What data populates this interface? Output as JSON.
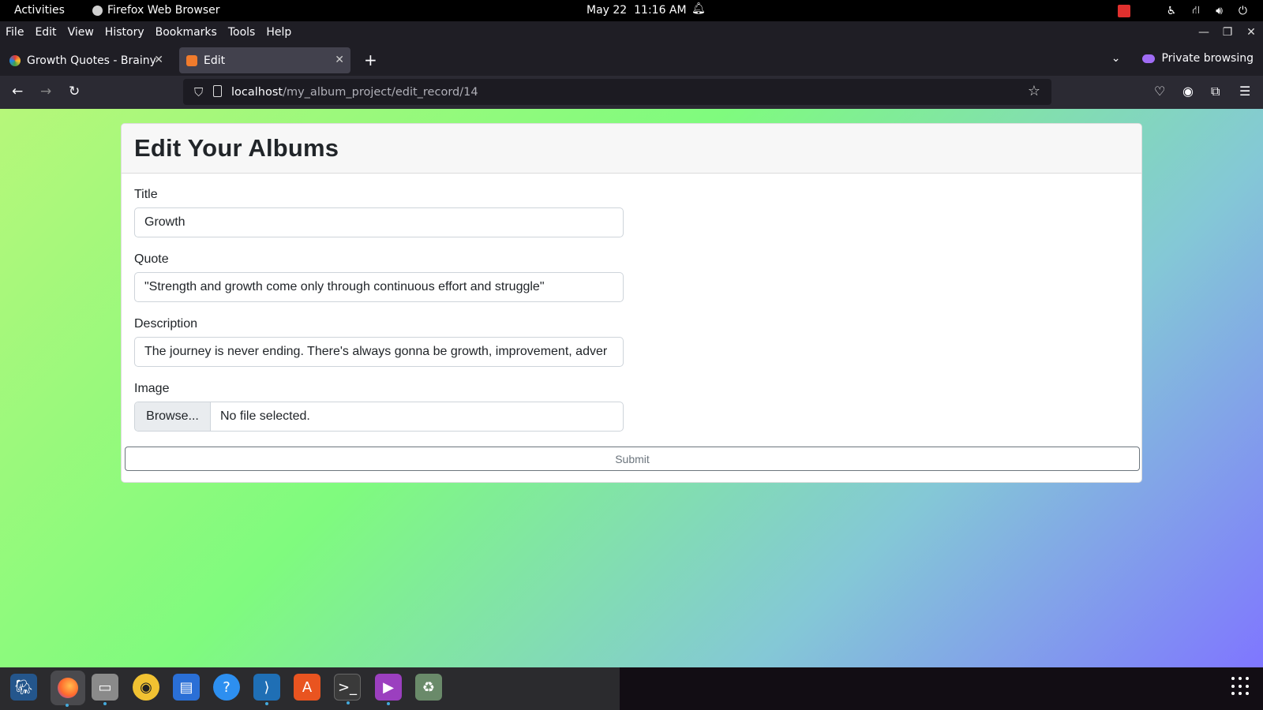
{
  "system_bar": {
    "activities": "Activities",
    "app_name": "Firefox Web Browser",
    "date": "May 22",
    "time": "11:16 AM"
  },
  "menu": {
    "items": [
      "File",
      "Edit",
      "View",
      "History",
      "Bookmarks",
      "Tools",
      "Help"
    ]
  },
  "tabs": [
    {
      "title": "Growth Quotes - BrainyQuote",
      "active": false
    },
    {
      "title": "Edit",
      "active": true
    }
  ],
  "private_label": "Private browsing",
  "url": {
    "host": "localhost",
    "path": "/my_album_project/edit_record/14"
  },
  "form": {
    "heading": "Edit Your Albums",
    "title_label": "Title",
    "title_value": "Growth",
    "quote_label": "Quote",
    "quote_value": "\"Strength and growth come only through continuous effort and struggle\"",
    "description_label": "Description",
    "description_value": "The journey is never ending. There's always gonna be growth, improvement, adver",
    "image_label": "Image",
    "browse_label": "Browse...",
    "no_file_label": "No file selected.",
    "submit_label": "Submit"
  },
  "dock_icons": [
    "pgadmin-icon",
    "firefox-icon",
    "files-icon",
    "rhythmbox-icon",
    "writer-icon",
    "help-icon",
    "vscode-icon",
    "software-icon",
    "terminal-icon",
    "media-icon",
    "trash-icon"
  ],
  "colors": {
    "accent_private": "#a06cf5",
    "page_gradient_start": "#b6f77a",
    "page_gradient_end": "#7f76ff"
  }
}
